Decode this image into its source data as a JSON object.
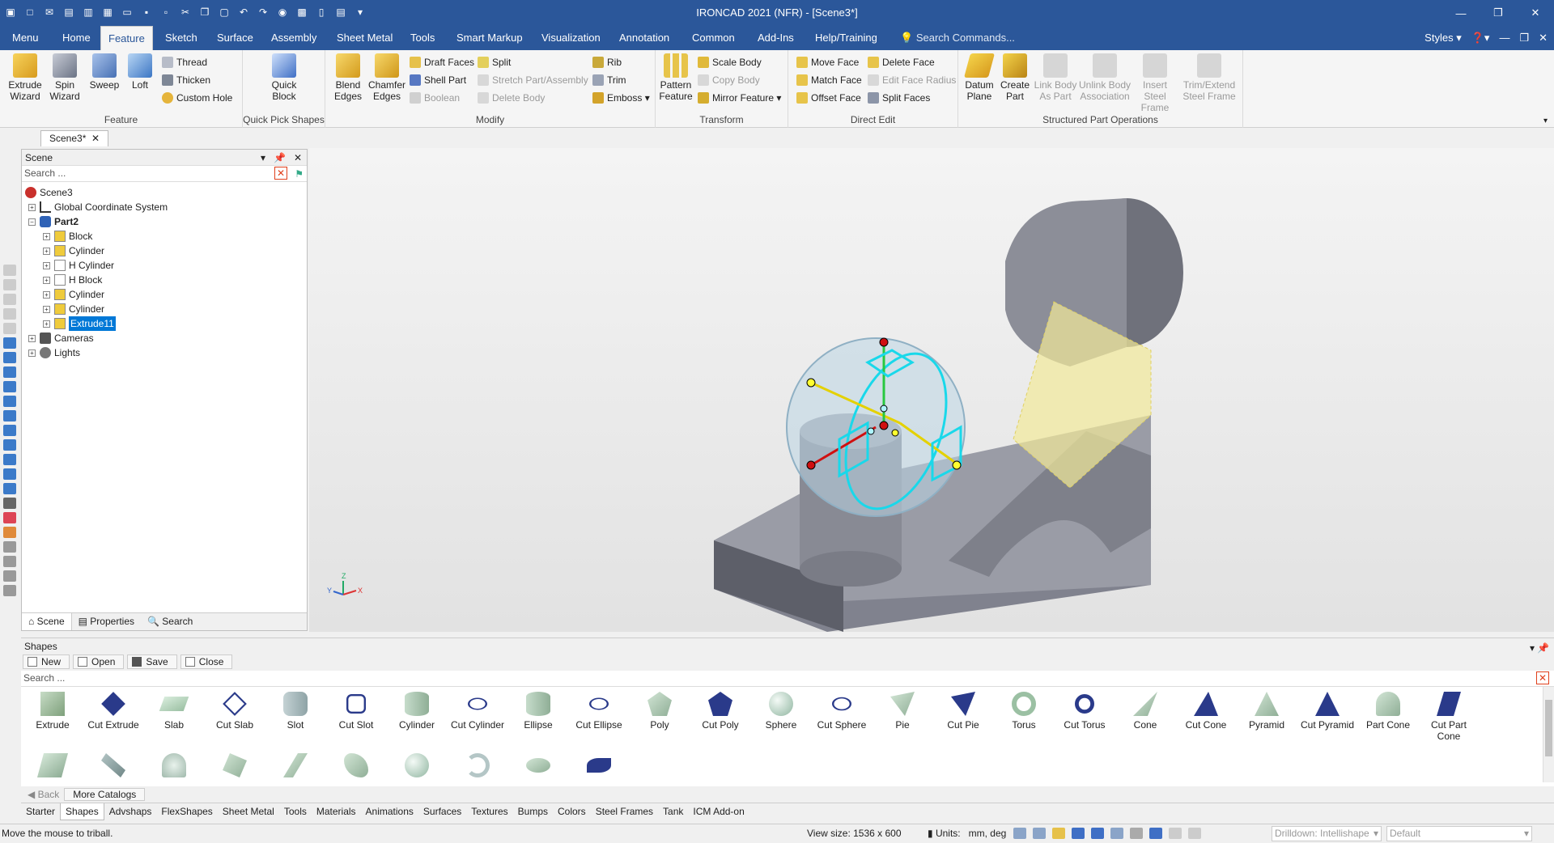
{
  "app": {
    "title": "IRONCAD 2021 (NFR) - [Scene3*]"
  },
  "colors": {
    "accent": "#2b579a",
    "selection": "#0078d7",
    "part": "#7a7c86",
    "highlight_cyan": "#19d8ea",
    "highlight_yellow": "#f2ea9a"
  },
  "menu_tabs": [
    {
      "label": "Menu"
    },
    {
      "label": "Home"
    },
    {
      "label": "Feature"
    },
    {
      "label": "Sketch"
    },
    {
      "label": "Surface"
    },
    {
      "label": "Assembly"
    },
    {
      "label": "Sheet Metal"
    },
    {
      "label": "Tools"
    },
    {
      "label": "Smart Markup"
    },
    {
      "label": "Visualization"
    },
    {
      "label": "Annotation"
    },
    {
      "label": "Common"
    },
    {
      "label": "Add-Ins"
    },
    {
      "label": "Help/Training"
    }
  ],
  "ribbon_search": {
    "placeholder": "Search Commands..."
  },
  "styles_label": "Styles",
  "ribbon": {
    "feature": {
      "label": "Feature",
      "extrude": "Extrude Wizard",
      "spin": "Spin Wizard",
      "sweep": "Sweep",
      "loft": "Loft",
      "thread": "Thread",
      "thicken": "Thicken",
      "custom_hole": "Custom Hole"
    },
    "quickpick": {
      "label": "Quick Pick Shapes",
      "quick_block": "Quick Block"
    },
    "modify": {
      "label": "Modify",
      "blend": "Blend Edges",
      "chamfer": "Chamfer Edges",
      "draft": "Draft Faces",
      "shell": "Shell Part",
      "boolean": "Boolean",
      "split": "Split",
      "stretch": "Stretch Part/Assembly",
      "delete_body": "Delete Body",
      "rib": "Rib",
      "trim": "Trim",
      "emboss": "Emboss"
    },
    "transform": {
      "label": "Transform",
      "pattern": "Pattern Feature",
      "scale": "Scale Body",
      "copy": "Copy Body",
      "mirror": "Mirror Feature"
    },
    "direct": {
      "label": "Direct Edit",
      "move_face": "Move Face",
      "match_face": "Match Face",
      "offset_face": "Offset Face",
      "delete_face": "Delete Face",
      "edit_radius": "Edit Face Radius",
      "split_faces": "Split Faces"
    },
    "structured": {
      "label": "Structured Part Operations",
      "datum": "Datum Plane",
      "create_part": "Create Part",
      "link_body": "Link Body As Part",
      "unlink": "Unlink Body Association",
      "insert_steel": "Insert Steel Frame",
      "trim_steel": "Trim/Extend Steel Frame"
    }
  },
  "document_tab": "Scene3*",
  "scene_panel": {
    "title": "Scene",
    "search_placeholder": "Search ...",
    "tree": [
      {
        "label": "Scene3",
        "level": 0
      },
      {
        "label": "Global Coordinate System",
        "level": 1
      },
      {
        "label": "Part2",
        "level": 1
      },
      {
        "label": "Block",
        "level": 2
      },
      {
        "label": "Cylinder",
        "level": 2
      },
      {
        "label": "H Cylinder",
        "level": 2
      },
      {
        "label": "H Block",
        "level": 2
      },
      {
        "label": "Cylinder",
        "level": 2
      },
      {
        "label": "Cylinder",
        "level": 2
      },
      {
        "label": "Extrude11",
        "level": 2
      },
      {
        "label": "Cameras",
        "level": 1
      },
      {
        "label": "Lights",
        "level": 1
      }
    ],
    "tabs": [
      "Scene",
      "Properties",
      "Search"
    ]
  },
  "triad_axes": {
    "x": "X",
    "y": "Y",
    "z": "Z"
  },
  "shapes_panel": {
    "title": "Shapes",
    "buttons": [
      "New",
      "Open",
      "Save",
      "Close"
    ],
    "search_placeholder": "Search ...",
    "items": [
      "Extrude",
      "Cut Extrude",
      "Slab",
      "Cut Slab",
      "Slot",
      "Cut Slot",
      "Cylinder",
      "Cut Cylinder",
      "Ellipse",
      "Cut Ellipse",
      "Poly",
      "Cut Poly",
      "Sphere",
      "Cut Sphere",
      "Pie",
      "Cut Pie",
      "Torus",
      "Cut Torus",
      "Cone",
      "Cut Cone",
      "Pyramid",
      "Cut Pyramid",
      "Part Cone",
      "Cut Part Cone"
    ],
    "back": "Back",
    "more": "More Catalogs",
    "catalog_tabs": [
      "Starter",
      "Shapes",
      "Advshaps",
      "FlexShapes",
      "Sheet Metal",
      "Tools",
      "Materials",
      "Animations",
      "Surfaces",
      "Textures",
      "Bumps",
      "Colors",
      "Steel Frames",
      "Tank",
      "ICM Add-on"
    ]
  },
  "status": {
    "message": "Move the mouse to triball.",
    "view_size": "View size: 1536 x  600",
    "units": "Units:",
    "units_value": "mm, deg",
    "drilldown": "Drilldown: Intellishape",
    "default": "Default"
  }
}
